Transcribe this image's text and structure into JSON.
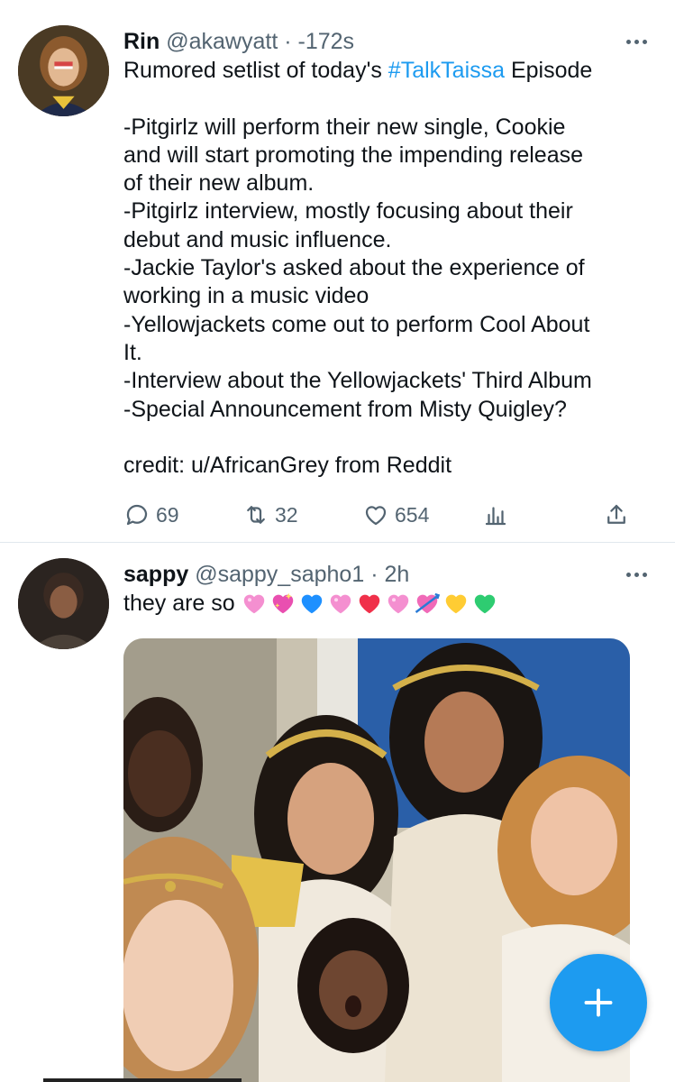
{
  "tweet1": {
    "name": "Rin",
    "handle": "@akawyatt",
    "separator": "·",
    "time": "-172s",
    "text_before_hashtag": "Rumored setlist of today's ",
    "hashtag": "#TalkTaissa",
    "text_after_hashtag": " Episode\n\n-Pitgirlz will perform their new single, Cookie\nand will start promoting the impending release\nof their new album.\n-Pitgirlz interview, mostly focusing about their\ndebut and music influence.\n-Jackie Taylor's asked about the experience of\nworking in a music video\n-Yellowjackets come out to perform Cool About\nIt.\n-Interview about the Yellowjackets' Third Album\n-Special Announcement from Misty Quigley?\n\ncredit: u/AfricanGrey from Reddit",
    "replies": "69",
    "retweets": "32",
    "likes": "654"
  },
  "tweet2": {
    "name": "sappy",
    "handle": "@sappy_sapho1",
    "separator": "·",
    "time": "2h",
    "text": "they are so",
    "heart_emojis": [
      "pink-heart",
      "sparkling-heart",
      "blue-heart",
      "pink-heart",
      "red-heart",
      "pink-heart",
      "heart-with-arrow",
      "yellow-heart",
      "green-heart"
    ]
  },
  "colors": {
    "accent": "#1d9bf0",
    "secondary_text": "#536471",
    "primary_text": "#0f1419",
    "divider": "#e1e8ed"
  },
  "icons": {
    "reply": "reply-icon",
    "retweet": "retweet-icon",
    "like": "like-icon",
    "analytics": "analytics-icon",
    "share": "share-icon",
    "more": "more-icon",
    "compose": "compose-plus-icon"
  }
}
